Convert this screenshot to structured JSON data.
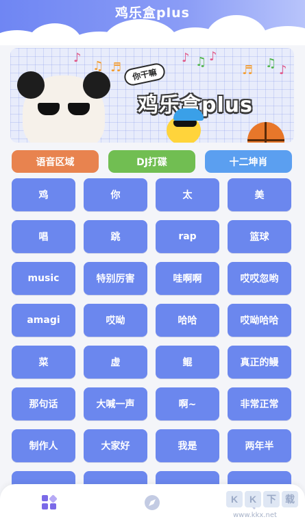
{
  "header": {
    "title": "鸡乐盒plus"
  },
  "banner": {
    "badge": "你干嘛",
    "title": "鸡乐盒plus"
  },
  "categories": [
    {
      "label": "语音区域",
      "color": "#e8834f"
    },
    {
      "label": "DJ打碟",
      "color": "#71be52"
    },
    {
      "label": "十二坤肖",
      "color": "#5b9ff0"
    }
  ],
  "sounds": [
    "鸡",
    "你",
    "太",
    "美",
    "唱",
    "跳",
    "rap",
    "篮球",
    "music",
    "特别厉害",
    "哇啊啊",
    "哎哎忽哟",
    "amagi",
    "哎呦",
    "哈哈",
    "哎呦哈哈",
    "菜",
    "虚",
    "鲲",
    "真正的鳗",
    "那句话",
    "大喊一声",
    "啊~",
    "非常正常",
    "制作人",
    "大家好",
    "我是",
    "两年半",
    "",
    "",
    "",
    ""
  ],
  "colors": {
    "button": "#6b87ee",
    "header": "#6f86f3"
  },
  "bottom_nav": {
    "items": [
      "grid-icon",
      "compass-icon",
      "share-icon"
    ]
  },
  "watermark": {
    "chars": [
      "K",
      "K",
      "下",
      "载"
    ],
    "url": "www.kkx.net"
  }
}
